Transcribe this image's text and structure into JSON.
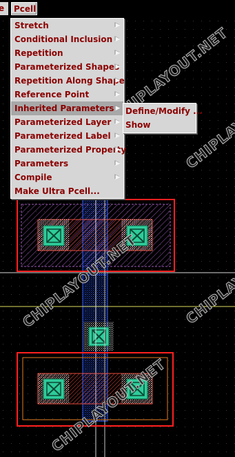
{
  "menubar": {
    "prev_label": "e",
    "pcell_label": "Pcell"
  },
  "pcell_menu": {
    "items": [
      {
        "label": "Stretch"
      },
      {
        "label": "Conditional Inclusion"
      },
      {
        "label": "Repetition"
      },
      {
        "label": "Parameterized Shapes"
      },
      {
        "label": "Repetition Along Shape"
      },
      {
        "label": "Reference Point"
      },
      {
        "label": "Inherited Parameters"
      },
      {
        "label": "Parameterized Layer"
      },
      {
        "label": "Parameterized Label"
      },
      {
        "label": "Parameterized Property"
      },
      {
        "label": "Parameters"
      },
      {
        "label": "Compile"
      },
      {
        "label": "Make Ultra Pcell..."
      }
    ]
  },
  "submenu": {
    "items": [
      {
        "label": "Define/Modify ..."
      },
      {
        "label": "Show"
      }
    ]
  },
  "watermark": "CHIPLAYOUT.NET",
  "colors": {
    "menu_bg": "#d6d6d6",
    "menu_text": "#8b0000",
    "highlight": "#a8a8a8",
    "canvas_bg": "#000000",
    "contact": "#2ecc9a",
    "poly": "#1e3cff",
    "diffusion": "#c0392b",
    "boundary": "#ff2020",
    "implant": "#8e44ad"
  }
}
